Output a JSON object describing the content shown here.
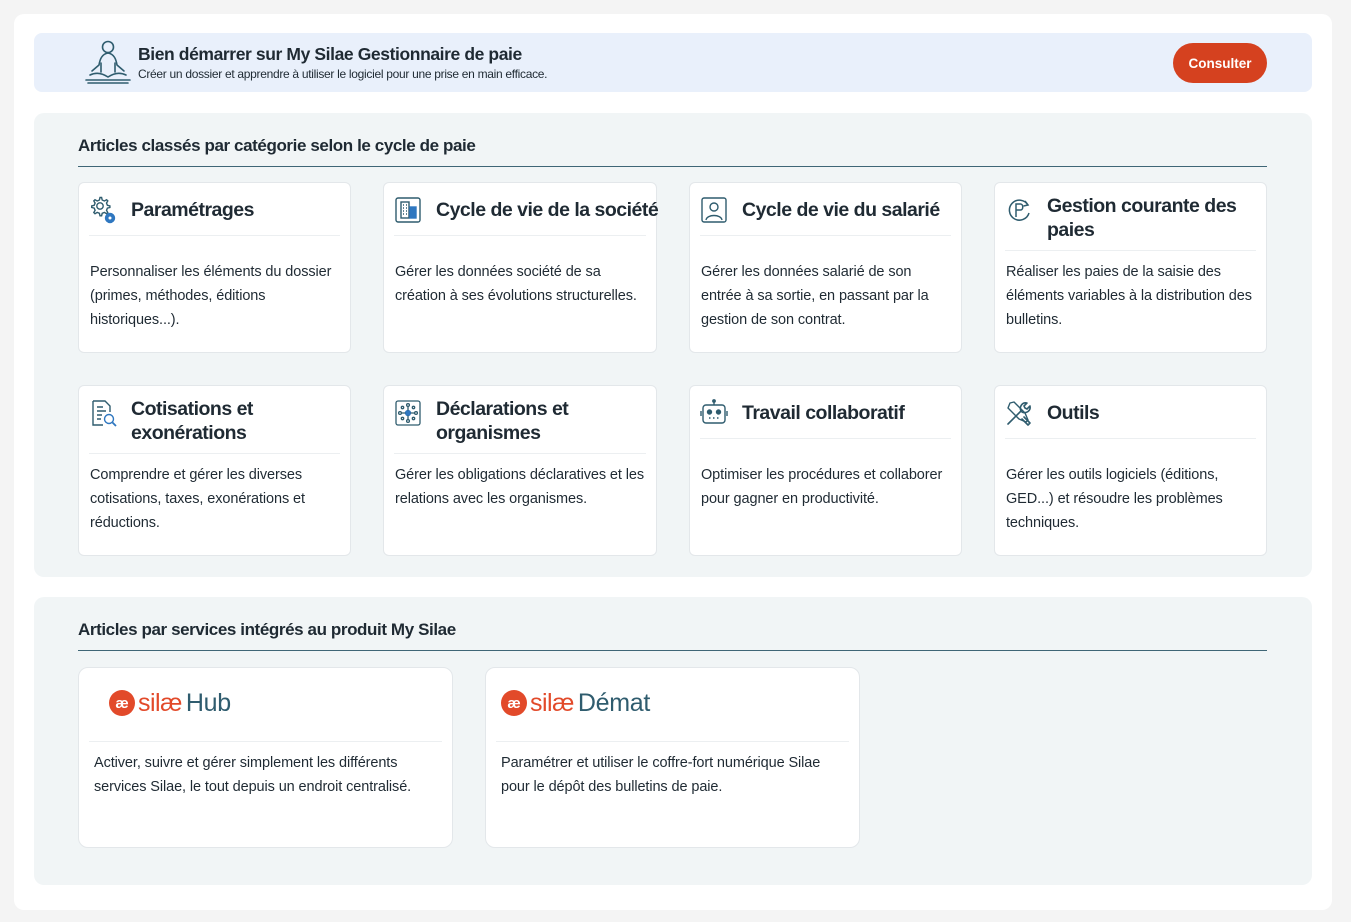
{
  "banner": {
    "title": "Bien démarrer sur My Silae Gestionnaire de paie",
    "subtitle": "Créer un dossier et apprendre à utiliser le logiciel pour une prise en main efficace.",
    "button_label": "Consulter",
    "icon": "meditation-person-icon"
  },
  "categories_section": {
    "title": "Articles classés par catégorie selon le cycle de paie",
    "cards": [
      {
        "title": "Paramétrages",
        "icon": "gear-icon",
        "description": "Personnaliser les éléments du dossier (primes, méthodes, éditions historiques...)."
      },
      {
        "title": "Cycle de vie de la société",
        "icon": "building-icon",
        "description": "Gérer les données société de sa création à ses évolutions structurelles."
      },
      {
        "title": "Cycle de vie du salarié",
        "icon": "user-badge-icon",
        "description": "Gérer les données salarié de son entrée à sa sortie, en passant par la gestion de son contrat."
      },
      {
        "title": "Gestion courante des paies",
        "icon": "payroll-cycle-icon",
        "description": "Réaliser les paies de la saisie des éléments variables à la distribution des bulletins."
      },
      {
        "title": "Cotisations et exonérations",
        "icon": "document-search-icon",
        "description": "Comprendre et gérer les diverses cotisations, taxes, exonérations et réductions."
      },
      {
        "title": "Déclarations et organismes",
        "icon": "network-icon",
        "description": "Gérer les obligations déclaratives et les relations avec les organismes."
      },
      {
        "title": "Travail collaboratif",
        "icon": "robot-icon",
        "description": "Optimiser les procédures et collaborer pour gagner en productivité."
      },
      {
        "title": "Outils",
        "icon": "tools-icon",
        "description": "Gérer les outils logiciels (éditions, GED...) et résoudre les problèmes techniques."
      }
    ]
  },
  "services_section": {
    "title": "Articles par services intégrés au produit My Silae",
    "cards": [
      {
        "logo_mark": "æ",
        "logo_brand": "silæ",
        "logo_product": "Hub",
        "description": "Activer, suivre et gérer simplement les différents services Silae, le tout depuis un endroit centralisé."
      },
      {
        "logo_mark": "æ",
        "logo_brand": "silæ",
        "logo_product": "Démat",
        "description": "Paramétrer et utiliser le coffre-fort numérique Silae pour le dépôt des bulletins de paie."
      }
    ]
  },
  "colors": {
    "accent": "#d5411f",
    "brand_orange": "#e24a2a",
    "brand_teal": "#2f5c6e",
    "banner_bg": "#e9f0fb",
    "section_bg": "#f1f5f6"
  }
}
